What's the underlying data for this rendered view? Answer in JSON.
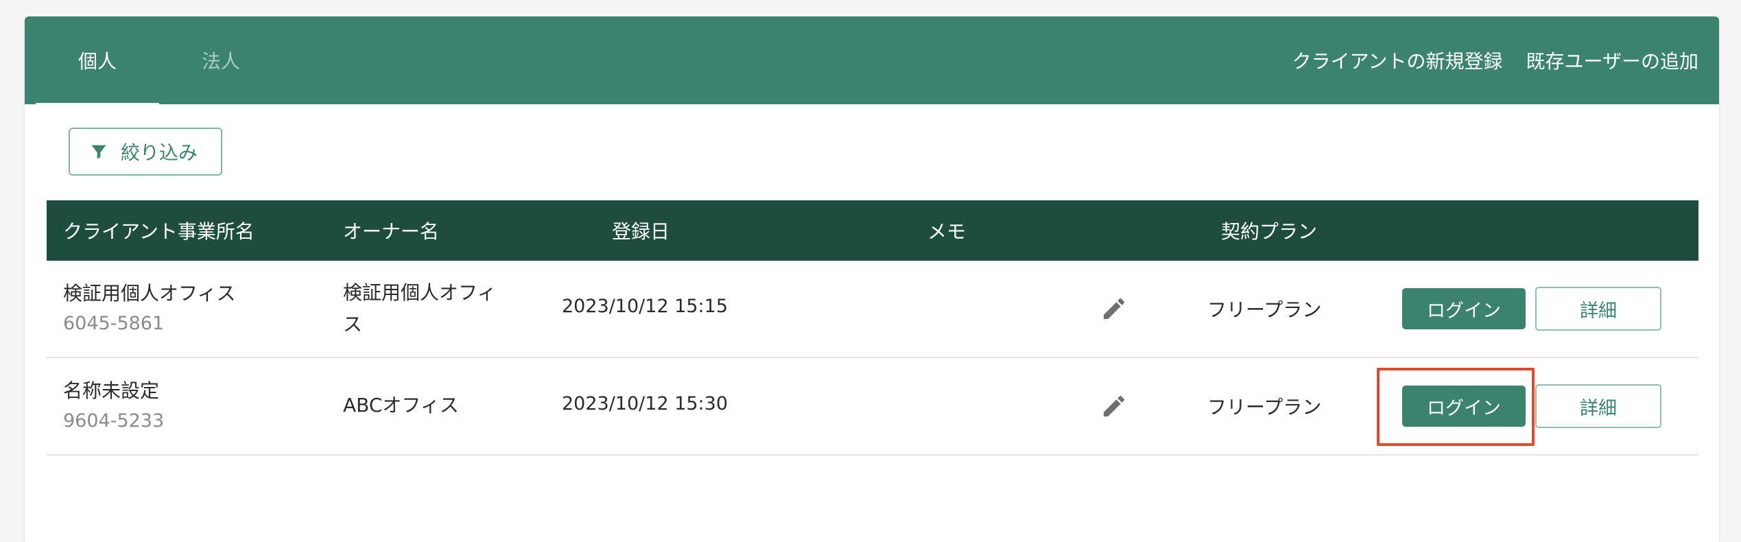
{
  "tabs": [
    {
      "label": "個人"
    },
    {
      "label": "法人"
    }
  ],
  "top_actions": {
    "new_client": "クライアントの新規登録",
    "add_existing_user": "既存ユーザーの追加"
  },
  "filter": {
    "label": "絞り込み"
  },
  "table": {
    "headers": {
      "office_name": "クライアント事業所名",
      "owner": "オーナー名",
      "registered": "登録日",
      "memo": "メモ",
      "plan": "契約プラン"
    },
    "rows": [
      {
        "name": "検証用個人オフィス",
        "code": "6045-5861",
        "owner": "検証用個人オフィス",
        "date": "2023/10/12 15:15",
        "plan": "フリープラン",
        "login": "ログイン",
        "detail": "詳細"
      },
      {
        "name": "名称未設定",
        "code": "9604-5233",
        "owner": "ABCオフィス",
        "date": "2023/10/12 15:30",
        "plan": "フリープラン",
        "login": "ログイン",
        "detail": "詳細"
      }
    ]
  },
  "colors": {
    "header_green": "#3b836e",
    "table_header": "#1e4d40",
    "highlight": "#e24a2b"
  },
  "icons": {
    "filter": "filter-icon",
    "edit": "pencil-icon"
  }
}
